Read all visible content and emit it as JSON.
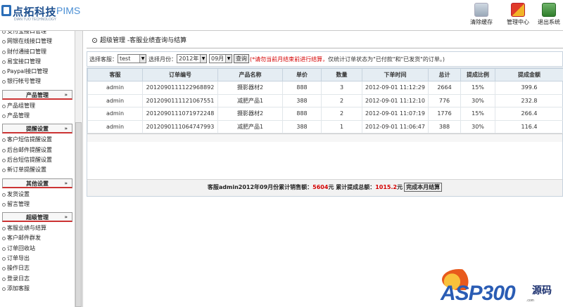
{
  "header": {
    "logo_cn": "点拓科技",
    "logo_en": "PIMS",
    "logo_sub": "DIAN TUO TECHNOLOGY",
    "buttons": [
      {
        "label": "清除缓存",
        "icon": "trash-icon"
      },
      {
        "label": "管理中心",
        "icon": "shield-icon"
      },
      {
        "label": "退出系统",
        "icon": "exit-icon"
      }
    ]
  },
  "sidebar": {
    "group0_items": [
      "支付宝接口管理",
      "网银在线接口管理",
      "财付通接口管理",
      "易宝接口管理",
      "Paypal接口管理",
      "银行帐号管理"
    ],
    "groups": [
      {
        "title": "产品管理",
        "chev": "»",
        "items": [
          "产品组管理",
          "产品管理"
        ]
      },
      {
        "title": "提醒设置",
        "chev": "»",
        "items": [
          "客户短信提醒设置",
          "后台邮件提醒设置",
          "后台短信提醒设置",
          "新订单提醒设置"
        ]
      },
      {
        "title": "其他设置",
        "chev": "»",
        "items": [
          "发货设置",
          "留言管理"
        ]
      },
      {
        "title": "超级管理",
        "chev": "»",
        "items": [
          "客服业绩与结算",
          "客户邮件群发",
          "订单回收站",
          "订单导出",
          "操作日志",
          "登录日志",
          "添加客服"
        ]
      }
    ]
  },
  "page": {
    "title": "超级管理 -客服业绩查询与结算"
  },
  "filter": {
    "kefu_label": "选择客服：",
    "kefu_value": "test",
    "month_label": "选择月份：",
    "year_value": "2012年",
    "month_value": "09月",
    "query_label": "查询",
    "note_red": "(*请勿当前月结束前进行结算，",
    "note_black": "仅统计订单状态为\"已付款\"和\"已发货\"的订单。)"
  },
  "table": {
    "headers": [
      "客服",
      "订单编号",
      "产品名称",
      "单价",
      "数量",
      "下单时间",
      "总计",
      "提成比例",
      "提成金额"
    ],
    "rows": [
      [
        "admin",
        "2012090111122968892",
        "摄影器材2",
        "888",
        "3",
        "2012-09-01 11:12:29",
        "2664",
        "15%",
        "399.6"
      ],
      [
        "admin",
        "2012090111121067551",
        "减肥产品1",
        "388",
        "2",
        "2012-09-01 11:12:10",
        "776",
        "30%",
        "232.8"
      ],
      [
        "admin",
        "2012090111071972248",
        "摄影器材2",
        "888",
        "2",
        "2012-09-01 11:07:19",
        "1776",
        "15%",
        "266.4"
      ],
      [
        "admin",
        "2012090111064747993",
        "减肥产品1",
        "388",
        "1",
        "2012-09-01 11:06:47",
        "388",
        "30%",
        "116.4"
      ]
    ]
  },
  "summary": {
    "prefix": "客服admin2012年09月份累计销售额：",
    "sales": "5604",
    "mid": "元 累计提成总额：",
    "commission": "1015.2",
    "suffix": "元",
    "button": "完成本月结算"
  },
  "watermark": {
    "brand": "ASP300",
    "cn": "源码",
    "url": ".com"
  }
}
